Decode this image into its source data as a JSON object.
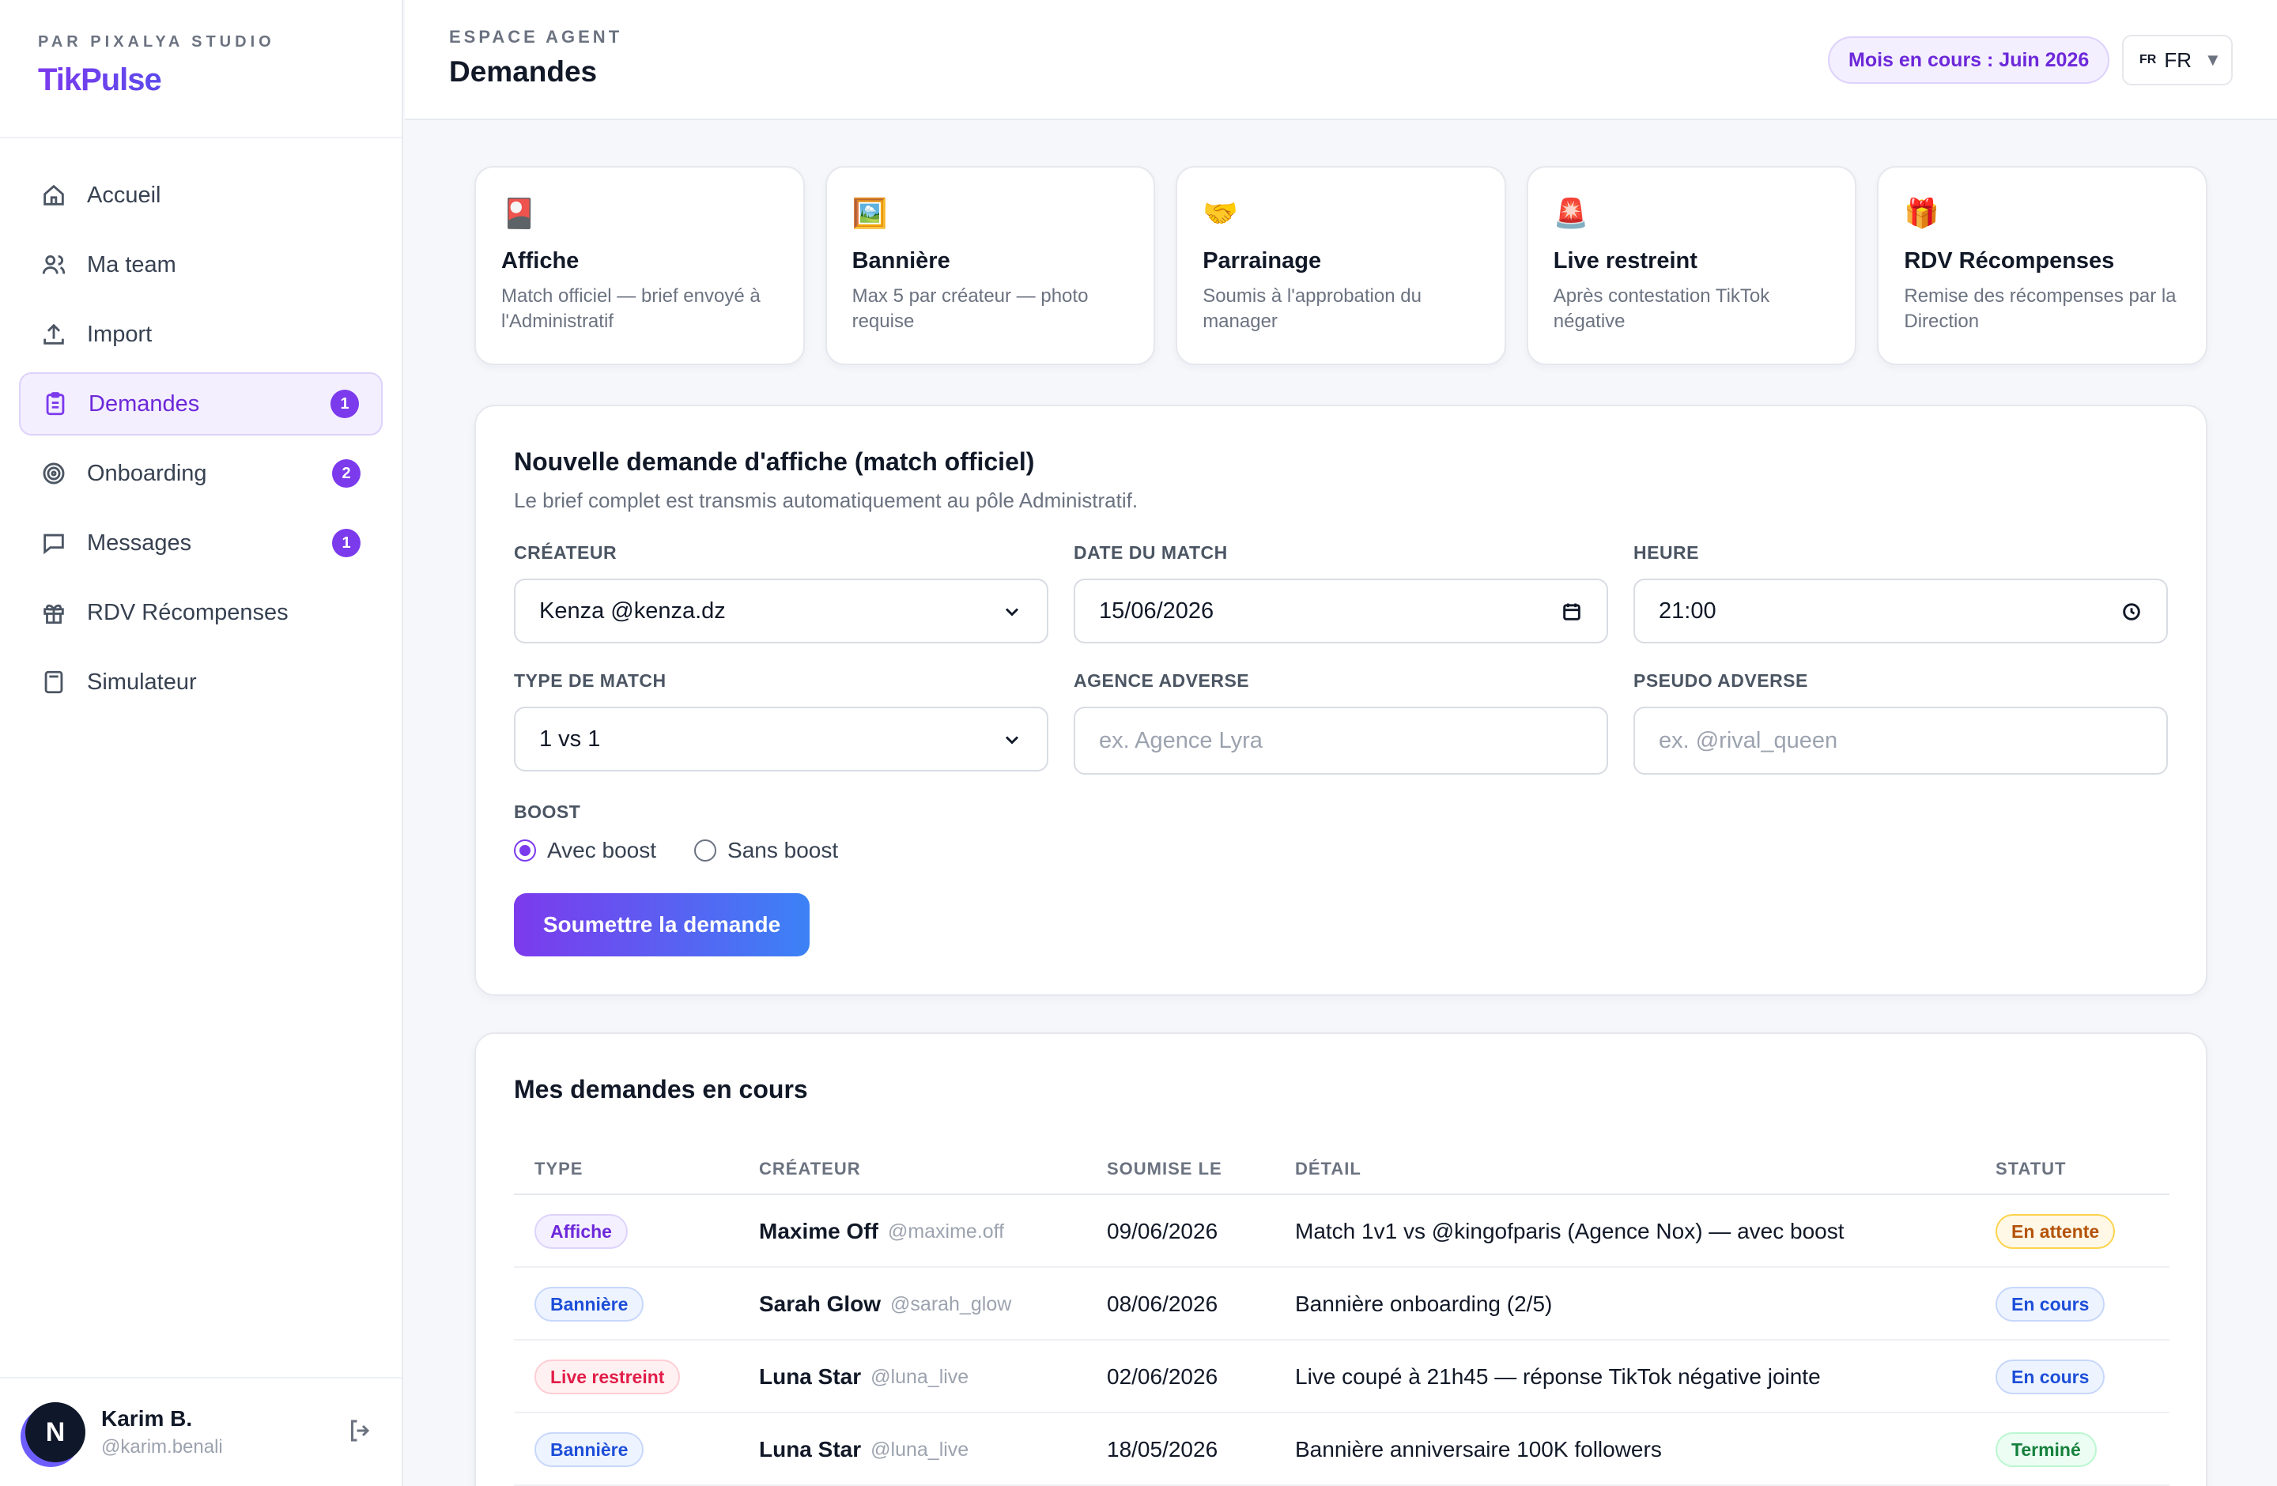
{
  "brand": {
    "studio": "PAR PIXALYA STUDIO",
    "name": "TikPulse"
  },
  "nav": [
    {
      "label": "Accueil",
      "icon": "home-icon",
      "badge": ""
    },
    {
      "label": "Ma team",
      "icon": "users-icon",
      "badge": ""
    },
    {
      "label": "Import",
      "icon": "upload-icon",
      "badge": ""
    },
    {
      "label": "Demandes",
      "icon": "clipboard-icon",
      "badge": "1",
      "active": true
    },
    {
      "label": "Onboarding",
      "icon": "target-icon",
      "badge": "2"
    },
    {
      "label": "Messages",
      "icon": "message-icon",
      "badge": "1"
    },
    {
      "label": "RDV Récompenses",
      "icon": "gift-icon",
      "badge": ""
    },
    {
      "label": "Simulateur",
      "icon": "calculator-icon",
      "badge": ""
    }
  ],
  "user": {
    "initial": "N",
    "name": "Karim B.",
    "handle": "@karim.benali"
  },
  "header": {
    "subtitle": "ESPACE AGENT",
    "title": "Demandes",
    "month": "Mois en cours : Juin 2026",
    "lang_flag": "FR",
    "lang": "FR"
  },
  "cards": [
    {
      "icon": "poster-icon",
      "glyph": "🎴",
      "title": "Affiche",
      "desc": "Match officiel — brief envoyé à l'Administratif"
    },
    {
      "icon": "picture-icon",
      "glyph": "🖼️",
      "title": "Bannière",
      "desc": "Max 5 par créateur — photo requise"
    },
    {
      "icon": "handshake-icon",
      "glyph": "🤝",
      "title": "Parrainage",
      "desc": "Soumis à l'approbation du manager"
    },
    {
      "icon": "alarm-icon",
      "glyph": "🚨",
      "title": "Live restreint",
      "desc": "Après contestation TikTok négative"
    },
    {
      "icon": "gift-box-icon",
      "glyph": "🎁",
      "title": "RDV Récompenses",
      "desc": "Remise des récompenses par la Direction"
    }
  ],
  "form": {
    "title": "Nouvelle demande d'affiche (match officiel)",
    "subtitle": "Le brief complet est transmis automatiquement au pôle Administratif.",
    "creator_label": "CRÉATEUR",
    "creator_value": "Kenza @kenza.dz",
    "date_label": "DATE DU MATCH",
    "date_value": "15/06/2026",
    "time_label": "HEURE",
    "time_value": "21:00",
    "type_label": "TYPE DE MATCH",
    "type_value": "1 vs 1",
    "agency_label": "AGENCE ADVERSE",
    "agency_placeholder": "ex. Agence Lyra",
    "pseudo_label": "PSEUDO ADVERSE",
    "pseudo_placeholder": "ex. @rival_queen",
    "boost_label": "BOOST",
    "boost_on": "Avec boost",
    "boost_off": "Sans boost",
    "submit": "Soumettre la demande"
  },
  "requests": {
    "title": "Mes demandes en cours",
    "columns": [
      "TYPE",
      "CRÉATEUR",
      "SOUMISE LE",
      "DÉTAIL",
      "STATUT"
    ],
    "rows": [
      {
        "type": "Affiche",
        "type_class": "t-affiche",
        "name": "Maxime Off",
        "handle": "@maxime.off",
        "date": "09/06/2026",
        "detail": "Match 1v1 vs @kingofparis (Agence Nox) — avec boost",
        "status": "En attente",
        "status_class": "s-attente"
      },
      {
        "type": "Bannière",
        "type_class": "t-banniere",
        "name": "Sarah Glow",
        "handle": "@sarah_glow",
        "date": "08/06/2026",
        "detail": "Bannière onboarding (2/5)",
        "status": "En cours",
        "status_class": "s-cours"
      },
      {
        "type": "Live restreint",
        "type_class": "t-live",
        "name": "Luna Star",
        "handle": "@luna_live",
        "date": "02/06/2026",
        "detail": "Live coupé à 21h45 — réponse TikTok négative jointe",
        "status": "En cours",
        "status_class": "s-cours"
      },
      {
        "type": "Bannière",
        "type_class": "t-banniere",
        "name": "Luna Star",
        "handle": "@luna_live",
        "date": "18/05/2026",
        "detail": "Bannière anniversaire 100K followers",
        "status": "Terminé",
        "status_class": "s-termine"
      }
    ]
  }
}
